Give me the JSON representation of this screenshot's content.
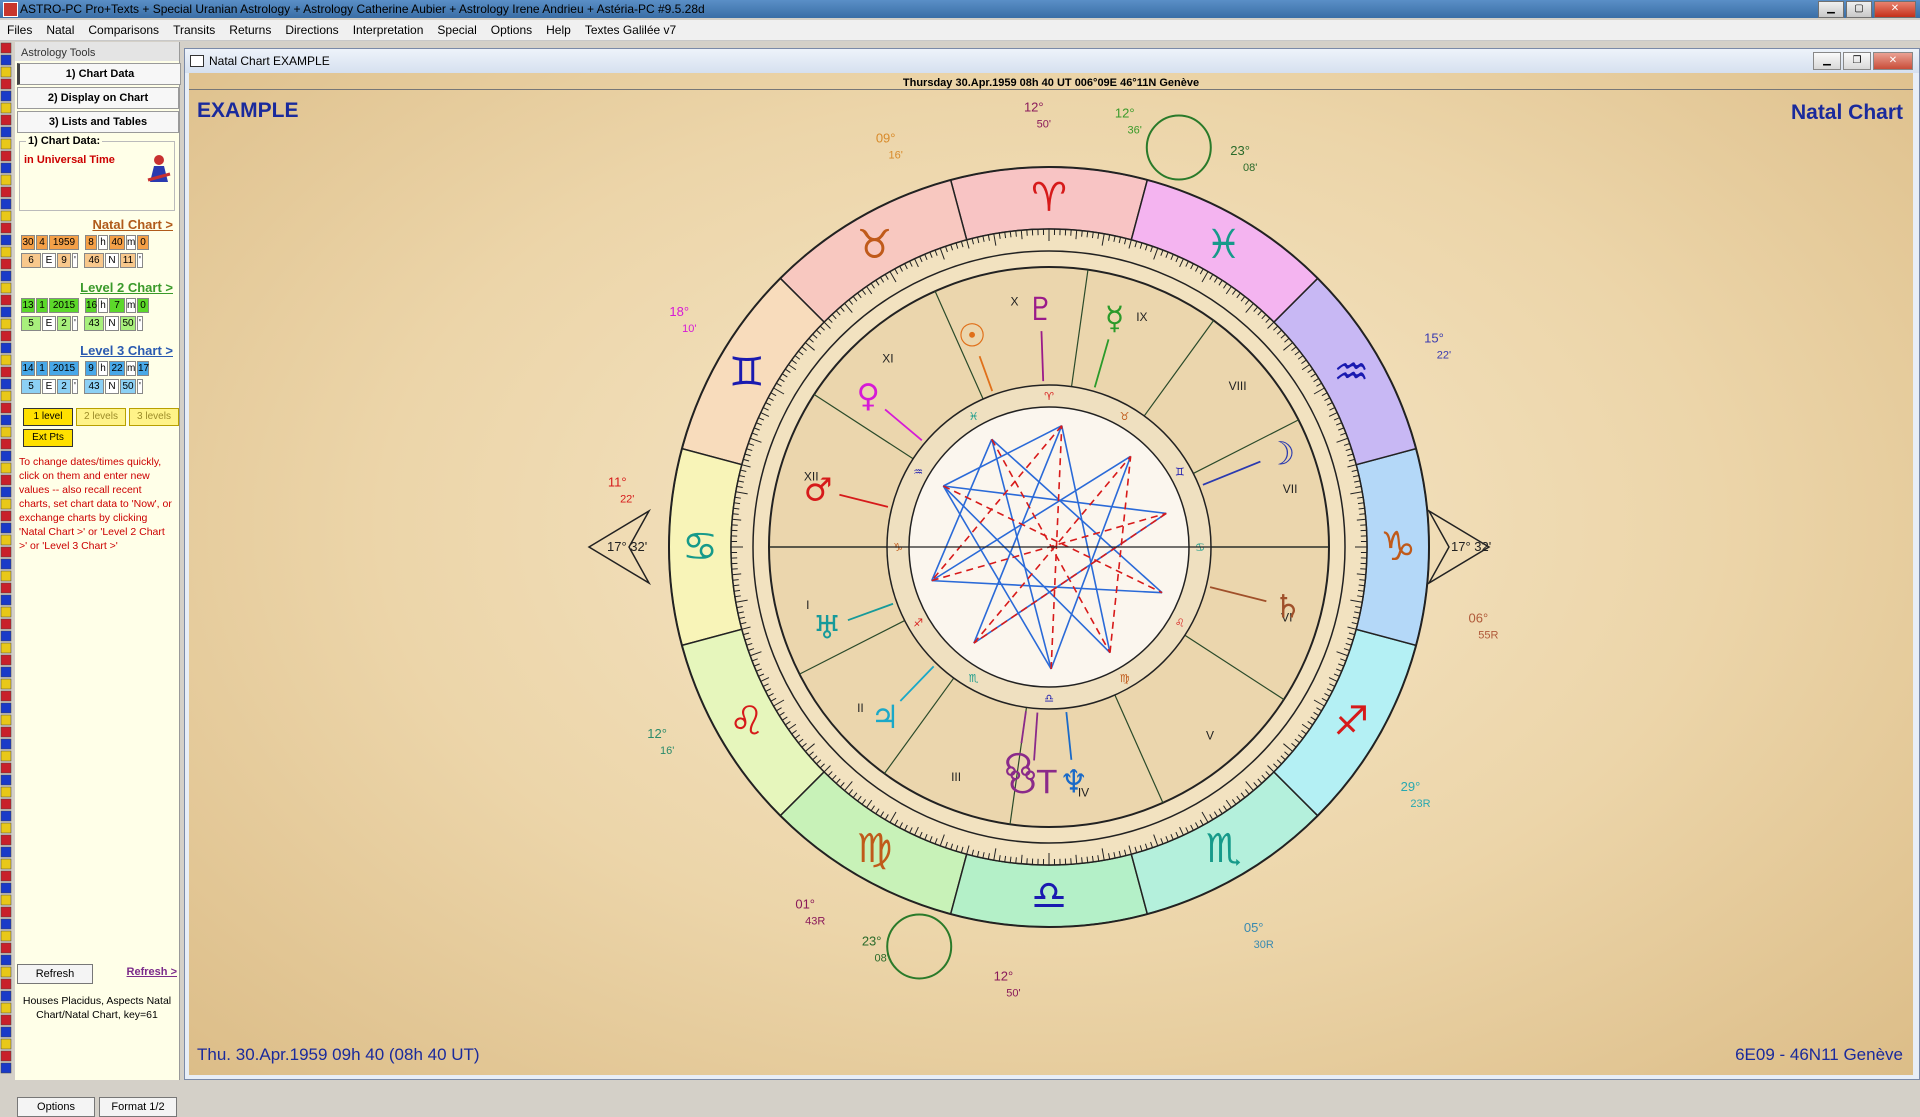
{
  "window": {
    "title": "ASTRO-PC Pro+Texts + Special Uranian Astrology + Astrology Catherine Aubier + Astrology Irene Andrieu + Astéria-PC #9.5.28d"
  },
  "menu": [
    "Files",
    "Natal",
    "Comparisons",
    "Transits",
    "Returns",
    "Directions",
    "Interpretation",
    "Special",
    "Options",
    "Help",
    "Textes Galilée v7"
  ],
  "sidebar": {
    "header": "Astrology Tools",
    "buttons": [
      "1) Chart Data",
      "2) Display on Chart",
      "3) Lists and Tables"
    ],
    "group_title": "1) Chart Data:",
    "time_mode": "in Universal Time",
    "natal": {
      "link": "Natal Chart >",
      "row1": [
        "30",
        "4",
        "1959",
        "8",
        "h",
        "40",
        "m",
        "0"
      ],
      "row2": [
        "6",
        "E",
        "9",
        "'",
        "46",
        "N",
        "11",
        "'"
      ]
    },
    "level2": {
      "link": "Level 2 Chart >",
      "row1": [
        "13",
        "1",
        "2015",
        "16",
        "h",
        "7",
        "m",
        "0"
      ],
      "row2": [
        "5",
        "E",
        "2",
        "'",
        "43",
        "N",
        "50",
        "'"
      ]
    },
    "level3": {
      "link": "Level 3 Chart >",
      "row1": [
        "14",
        "1",
        "2015",
        "9",
        "h",
        "22",
        "m",
        "17"
      ],
      "row2": [
        "5",
        "E",
        "2",
        "'",
        "43",
        "N",
        "50",
        "'"
      ]
    },
    "levels": [
      "1 level",
      "2 levels",
      "3 levels"
    ],
    "ext_pts": "Ext Pts",
    "help": "To change dates/times quickly, click on them and enter new values -- also recall recent charts, set chart data to 'Now', or exchange charts by clicking 'Natal Chart >' or 'Level 2 Chart >' or 'Level 3 Chart >'",
    "refresh": "Refresh",
    "refresh_link": "Refresh >",
    "houses_info": "Houses Placidus, Aspects Natal Chart/Natal Chart, key=61",
    "options": "Options",
    "format": "Format 1/2"
  },
  "child": {
    "title": "Natal Chart  EXAMPLE",
    "header_date": "Thursday 30.Apr.1959 08h 40 UT 006°09E 46°11N  Genève",
    "name": "EXAMPLE",
    "chart_title": "Natal Chart",
    "bottom_left": "Thu. 30.Apr.1959 09h 40 (08h 40 UT)",
    "bottom_right": "6E09 - 46N11  Genève"
  },
  "wheel": {
    "signs": [
      {
        "glyph": "♈",
        "color": "#d61a1a",
        "bg": "#f8c4c4"
      },
      {
        "glyph": "♉",
        "color": "#c05a1a",
        "bg": "#f8c8c0"
      },
      {
        "glyph": "♊",
        "color": "#1a1ab0",
        "bg": "#f8dcbc"
      },
      {
        "glyph": "♋",
        "color": "#169a8a",
        "bg": "#f8f4b8"
      },
      {
        "glyph": "♌",
        "color": "#d61a1a",
        "bg": "#e6f6bc"
      },
      {
        "glyph": "♍",
        "color": "#c05a1a",
        "bg": "#c8f2b8"
      },
      {
        "glyph": "♎",
        "color": "#1a1ab0",
        "bg": "#b4f0c8"
      },
      {
        "glyph": "♏",
        "color": "#169a8a",
        "bg": "#b4f0dc"
      },
      {
        "glyph": "♐",
        "color": "#d61a1a",
        "bg": "#b4f0f4"
      },
      {
        "glyph": "♑",
        "color": "#c05a1a",
        "bg": "#b4d8f8"
      },
      {
        "glyph": "♒",
        "color": "#1a1ab0",
        "bg": "#c8b8f4"
      },
      {
        "glyph": "♓",
        "color": "#169a8a",
        "bg": "#f4b4f0"
      }
    ],
    "house_numbers": [
      "I",
      "II",
      "III",
      "IV",
      "V",
      "VI",
      "VII",
      "VIII",
      "IX",
      "X",
      "XI",
      "XII"
    ],
    "cusp_labels": [
      {
        "deg": "12°",
        "min": "50'",
        "color": "#8a1a5a"
      },
      {
        "deg": "12°",
        "min": "36'",
        "color": "#3a9a2a"
      },
      {
        "deg": "23°",
        "min": "08'",
        "color": "#2a6a2a"
      },
      {
        "deg": "15°",
        "min": "22'",
        "color": "#3a3ab0"
      },
      {
        "deg": "06°",
        "min": "55R",
        "color": "#b05a3a"
      },
      {
        "deg": "29°",
        "min": "23R",
        "color": "#28a8b0"
      },
      {
        "deg": "05°",
        "min": "30R",
        "color": "#3a8ab0"
      },
      {
        "deg": "12°",
        "min": "50'",
        "color": "#8a1a5a"
      },
      {
        "deg": "23°",
        "min": "08'",
        "color": "#2a6a2a"
      },
      {
        "deg": "01°",
        "min": "43R",
        "color": "#8a1a5a"
      },
      {
        "deg": "12°",
        "min": "16'",
        "color": "#2a8a6a"
      },
      {
        "deg": "11°",
        "min": "22'",
        "color": "#d61a1a"
      },
      {
        "deg": "18°",
        "min": "10'",
        "color": "#d61ad6"
      },
      {
        "deg": "09°",
        "min": "16'",
        "color": "#d88a2a"
      }
    ],
    "axis_labels": {
      "asc": "17° 32'",
      "dsc": "17° 32'"
    },
    "planets": [
      {
        "name": "Sun",
        "glyph": "☉",
        "color": "#e0701a"
      },
      {
        "name": "Moon",
        "glyph": "☽",
        "color": "#2a3ab0"
      },
      {
        "name": "Mercury",
        "glyph": "☿",
        "color": "#2a9a2a"
      },
      {
        "name": "Venus",
        "glyph": "♀",
        "color": "#d61ad6"
      },
      {
        "name": "Mars",
        "glyph": "♂",
        "color": "#d61a1a"
      },
      {
        "name": "Jupiter",
        "glyph": "♃",
        "color": "#1aa8c8"
      },
      {
        "name": "Saturn",
        "glyph": "♄",
        "color": "#a0502a"
      },
      {
        "name": "Uranus",
        "glyph": "♅",
        "color": "#169a9a"
      },
      {
        "name": "Neptune",
        "glyph": "♆",
        "color": "#1a6ac8"
      },
      {
        "name": "Pluto",
        "glyph": "♇",
        "color": "#9a1a8a"
      },
      {
        "name": "North Node",
        "glyph": "☊",
        "color": "#8a2a8a"
      },
      {
        "name": "South Node",
        "glyph": "☋T",
        "color": "#8a2a8a"
      }
    ],
    "inner_signs": [
      "♈",
      "♉",
      "♊",
      "♋",
      "♌",
      "♍",
      "♎",
      "♏",
      "♐",
      "♑",
      "♒",
      "♓"
    ]
  }
}
